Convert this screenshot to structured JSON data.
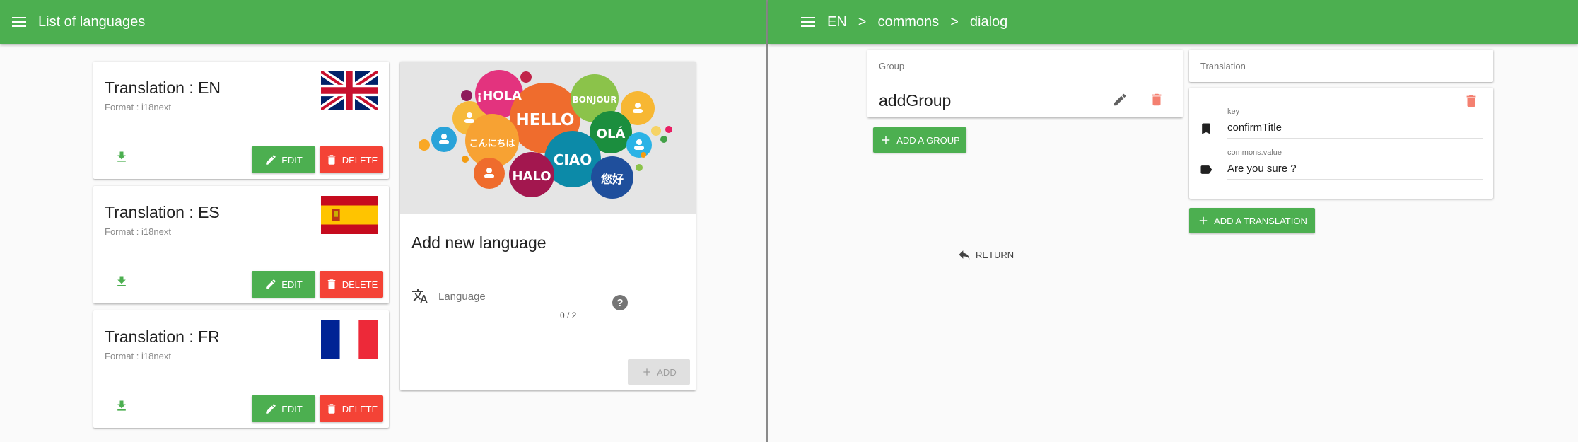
{
  "left": {
    "title": "List of languages",
    "translations": [
      {
        "title": "Translation : EN",
        "format": "Format : i18next",
        "edit": "EDIT",
        "delete": "DELETE"
      },
      {
        "title": "Translation : ES",
        "format": "Format : i18next",
        "edit": "EDIT",
        "delete": "DELETE"
      },
      {
        "title": "Translation : FR",
        "format": "Format : i18next",
        "edit": "EDIT",
        "delete": "DELETE"
      }
    ],
    "add_card": {
      "title": "Add new language",
      "placeholder": "Language",
      "counter": "0 / 2",
      "add_label": "ADD",
      "bubble_words": [
        "¡HOLA",
        "HELLO",
        "BONJOUR",
        "OLÁ",
        "こんにちは",
        "CIAO",
        "HALO",
        "您好"
      ]
    }
  },
  "right": {
    "breadcrumb": [
      "EN",
      "commons",
      "dialog"
    ],
    "separator": ">",
    "group_label": "Group",
    "group_name": "addGroup",
    "add_group_label": "ADD A GROUP",
    "translation_label": "Translation",
    "key_label": "key",
    "key_value": "confirmTitle",
    "value_label": "commons.value",
    "value_value": "Are you sure ?",
    "add_translation_label": "ADD A TRANSLATION",
    "return_label": "RETURN"
  },
  "colors": {
    "primary": "#4caf50",
    "danger": "#f44336",
    "background": "#fafafa"
  }
}
